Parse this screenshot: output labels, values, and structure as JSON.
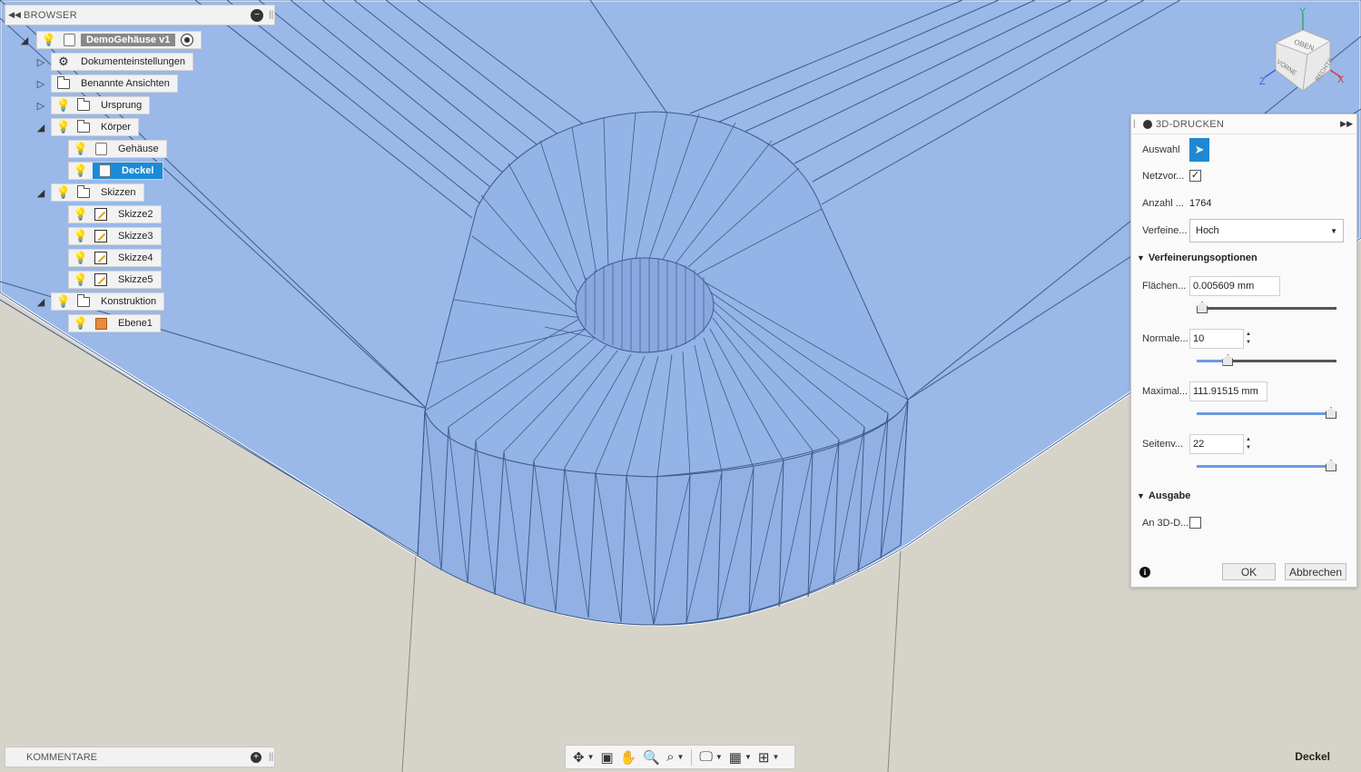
{
  "browser": {
    "title": "BROWSER",
    "root_label": "DemoGehäuse v1",
    "items": {
      "dokumenteinstellungen": "Dokumenteinstellungen",
      "benannte_ansichten": "Benannte Ansichten",
      "ursprung": "Ursprung",
      "koerper": "Körper",
      "gehaeuse": "Gehäuse",
      "deckel": "Deckel",
      "skizzen": "Skizzen",
      "skizze2": "Skizze2",
      "skizze3": "Skizze3",
      "skizze4": "Skizze4",
      "skizze5": "Skizze5",
      "konstruktion": "Konstruktion",
      "ebene1": "Ebene1"
    }
  },
  "comments": {
    "title": "KOMMENTARE"
  },
  "selection_label": "Deckel",
  "viewcube": {
    "top": "OBEN",
    "front": "VORNE",
    "right": "RECHTS",
    "axis_x": "X",
    "axis_y": "Y",
    "axis_z": "Z"
  },
  "dialog": {
    "title": "3D-DRUCKEN",
    "auswahl_label": "Auswahl",
    "netz_label": "Netzvor...",
    "netz_checked": true,
    "anzahl_label": "Anzahl ...",
    "anzahl_value": "1764",
    "verfeinerung_label": "Verfeine...",
    "verfeinerung_value": "Hoch",
    "section_options": "Verfeinerungsoptionen",
    "flaechen_label": "Flächen...",
    "flaechen_value": "0.005609 mm",
    "flaechen_slider": 0.0,
    "normalen_label": "Normale...",
    "normalen_value": "10",
    "normalen_slider": 0.2,
    "maximal_label": "Maximal...",
    "maximal_value": "111.91515 mm",
    "maximal_slider": 1.0,
    "seiten_label": "Seitenv...",
    "seiten_value": "22",
    "seiten_slider": 1.0,
    "section_output": "Ausgabe",
    "an3d_label": "An 3D-D...",
    "an3d_checked": false,
    "ok_label": "OK",
    "cancel_label": "Abbrechen",
    "info_icon": "i"
  },
  "colors": {
    "model": "#9ab8e8",
    "background": "#d6d3c8",
    "accent": "#1a8bd8"
  }
}
